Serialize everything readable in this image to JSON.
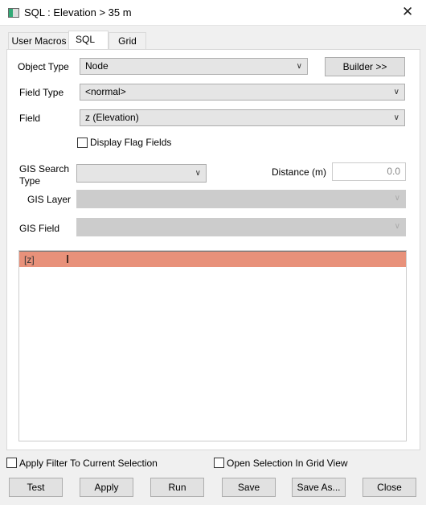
{
  "window": {
    "title": "SQL : Elevation > 35 m",
    "close": "✕"
  },
  "tabs": [
    {
      "label": "User Macros"
    },
    {
      "label": "SQL"
    },
    {
      "label": "Grid"
    }
  ],
  "form": {
    "object_type_label": "Object Type",
    "object_type_value": "Node",
    "builder_label": "Builder >>",
    "field_type_label": "Field Type",
    "field_type_value": "<normal>",
    "field_label": "Field",
    "field_value": "z  (Elevation)",
    "display_flag_label": "Display Flag Fields",
    "gis_search_type_label": "GIS Search Type",
    "gis_search_type_value": "",
    "distance_label": "Distance (m)",
    "distance_value": "0.0",
    "gis_layer_label": "GIS Layer",
    "gis_field_label": "GIS Field"
  },
  "sql": {
    "text": "[z]",
    "highlight_color": "#e8917a"
  },
  "options": {
    "apply_filter_label": "Apply Filter To Current Selection",
    "open_grid_label": "Open Selection In Grid View"
  },
  "buttons": {
    "test": "Test",
    "apply": "Apply",
    "run": "Run",
    "save": "Save",
    "save_as": "Save As...",
    "close": "Close"
  }
}
